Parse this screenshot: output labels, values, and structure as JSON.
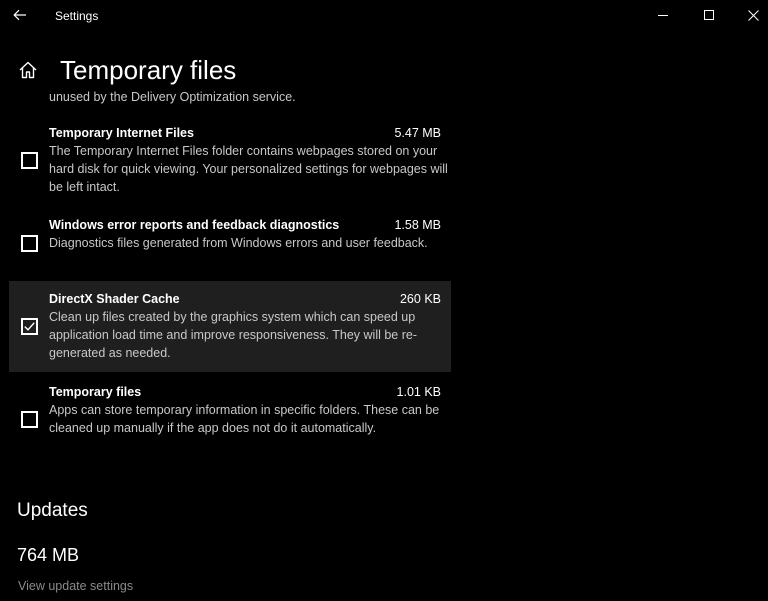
{
  "titlebar": {
    "app_title": "Settings",
    "back_icon": "back-arrow-icon",
    "minimize_icon": "minimize-icon",
    "maximize_icon": "maximize-icon",
    "close_icon": "close-icon"
  },
  "header": {
    "home_icon": "home-icon",
    "title": "Temporary files"
  },
  "content": {
    "cut_off_text": "unused by the Delivery Optimization service.",
    "items": [
      {
        "name": "Temporary Internet Files",
        "size": "5.47 MB",
        "checked": false,
        "description": "The Temporary Internet Files folder contains webpages stored on your hard disk for quick viewing. Your personalized settings for webpages will be left intact."
      },
      {
        "name": "Windows error reports and feedback diagnostics",
        "size": "1.58 MB",
        "checked": false,
        "description": "Diagnostics files generated from Windows errors and user feedback."
      },
      {
        "name": "DirectX Shader Cache",
        "size": "260 KB",
        "checked": true,
        "description": "Clean up files created by the graphics system which can speed up application load time and improve responsiveness. They will be re-generated as needed."
      },
      {
        "name": "Temporary files",
        "size": "1.01 KB",
        "checked": false,
        "description": "Apps can store temporary information in specific folders. These can be cleaned up manually if the app does not do it automatically."
      }
    ],
    "updates": {
      "heading": "Updates",
      "size": "764 MB",
      "link": "View update settings"
    }
  },
  "colors": {
    "background": "#000000",
    "selected_row": "#1f1f1f",
    "text_primary": "#ffffff",
    "text_secondary": "#c8c8c8",
    "link_muted": "#8a8a8a"
  }
}
